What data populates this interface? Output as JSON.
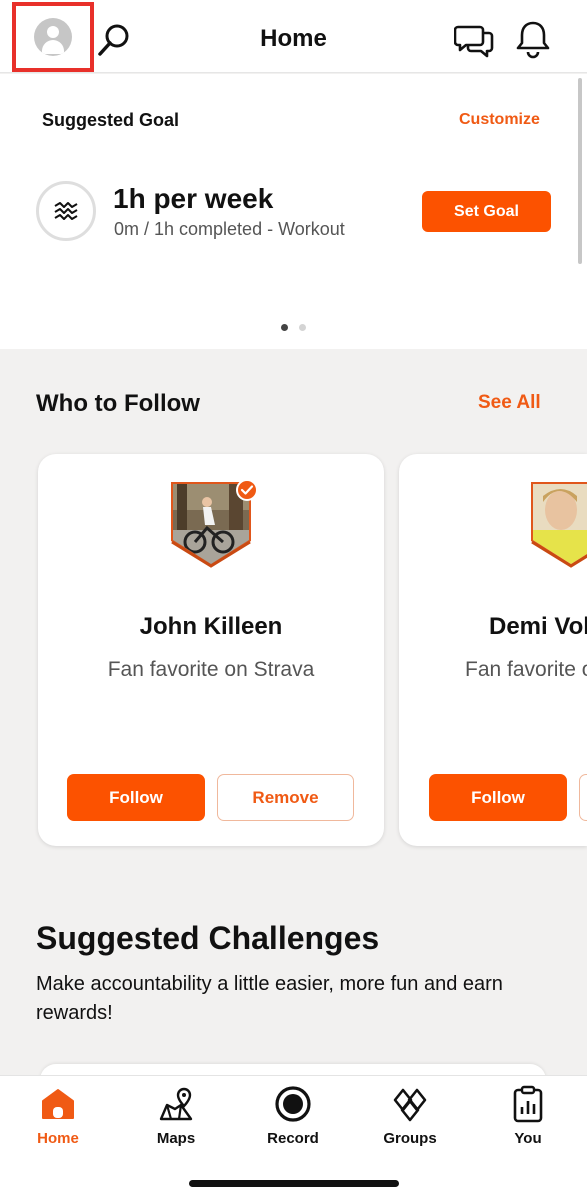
{
  "header": {
    "title": "Home"
  },
  "goal": {
    "heading": "Suggested Goal",
    "customize_label": "Customize",
    "value": "1h per week",
    "progress": "0m / 1h completed - Workout",
    "set_goal_label": "Set Goal",
    "pager_active_index": 0,
    "pager_count": 2
  },
  "who_to_follow": {
    "title": "Who to Follow",
    "see_all_label": "See All",
    "cards": [
      {
        "name": "John Killeen",
        "subtitle": "Fan favorite on Strava",
        "follow_label": "Follow",
        "remove_label": "Remove",
        "verified": true
      },
      {
        "name": "Demi Vol",
        "subtitle": "Fan favorite o",
        "follow_label": "Follow",
        "remove_label": ""
      }
    ]
  },
  "challenges": {
    "title": "Suggested Challenges",
    "description": "Make accountability a little easier, more fun and earn rewards!"
  },
  "tabs": [
    {
      "label": "Home",
      "icon": "home-icon",
      "active": true
    },
    {
      "label": "Maps",
      "icon": "maps-icon",
      "active": false
    },
    {
      "label": "Record",
      "icon": "record-icon",
      "active": false
    },
    {
      "label": "Groups",
      "icon": "groups-icon",
      "active": false
    },
    {
      "label": "You",
      "icon": "you-icon",
      "active": false
    }
  ],
  "colors": {
    "accent": "#fc5200",
    "accent_text": "#f05a14",
    "background": "#f2f1f0",
    "highlight_box": "#e8302a"
  }
}
